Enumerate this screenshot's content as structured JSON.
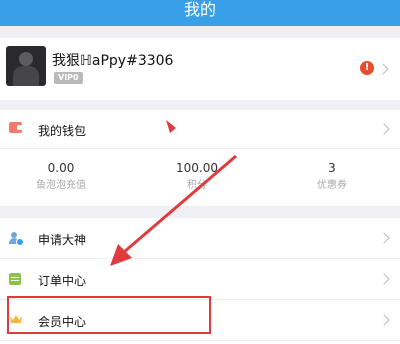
{
  "header": {
    "title": "我的"
  },
  "profile": {
    "username": "我狠ℍaPpy#3306",
    "vip_badge": "VIP0",
    "alert_icon": "alert-icon"
  },
  "wallet": {
    "label": "我的钱包",
    "stats": [
      {
        "value": "0.00",
        "label": "鱼泡泡充值"
      },
      {
        "value": "100.00",
        "label": "积分"
      },
      {
        "value": "3",
        "label": "优惠券"
      }
    ]
  },
  "menu": {
    "items": [
      {
        "label": "申请大神",
        "icon": "apply-icon"
      },
      {
        "label": "订单中心",
        "icon": "order-icon"
      },
      {
        "label": "会员中心",
        "icon": "crown-icon"
      }
    ]
  },
  "colors": {
    "header_blue": "#3a9fe9",
    "annotation_red": "#e0393e",
    "wallet_red": "#f07b6a"
  }
}
